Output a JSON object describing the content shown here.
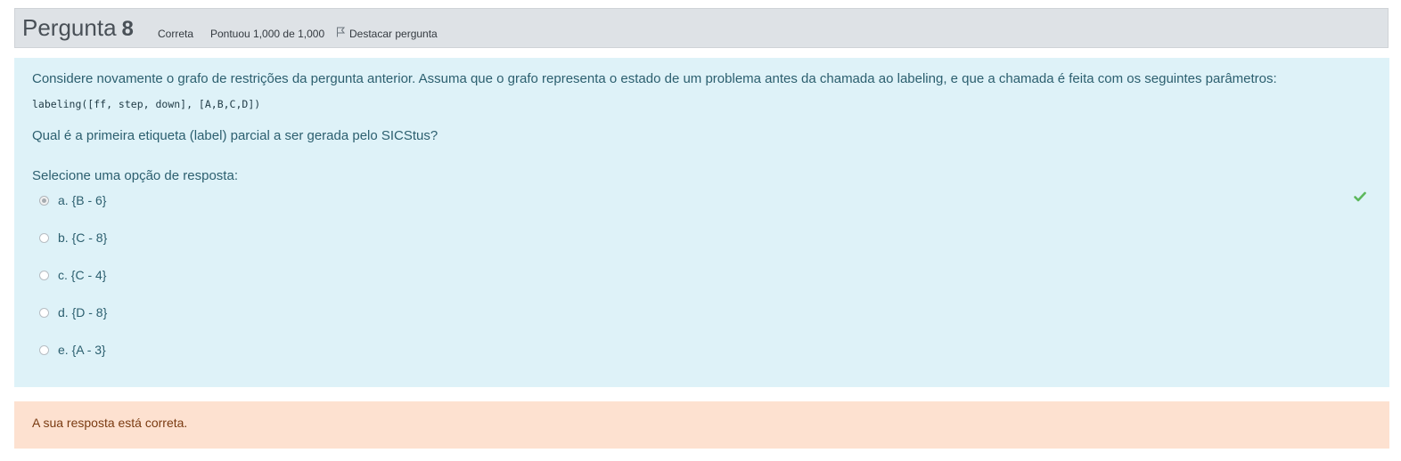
{
  "question": {
    "word": "Pergunta",
    "number": "8",
    "state": "Correta",
    "grade": "Pontuou 1,000 de 1,000",
    "flag_label": "Destacar pergunta",
    "flag_icon": "flag-icon"
  },
  "content": {
    "text1": "Considere novamente o grafo de restrições da pergunta anterior. Assuma que o grafo representa o estado de um problema antes da chamada ao labeling, e que a chamada é feita com os seguintes parâmetros:",
    "code": "labeling([ff, step, down], [A,B,C,D])",
    "text2": "Qual é a primeira etiqueta (label) parcial a ser gerada pelo SICStus?",
    "prompt": "Selecione uma opção de resposta:",
    "options": [
      {
        "label": "a. {B - 6}",
        "selected": true
      },
      {
        "label": "b. {C - 8}",
        "selected": false
      },
      {
        "label": "c. {C - 4}",
        "selected": false
      },
      {
        "label": "d. {D - 8}",
        "selected": false
      },
      {
        "label": "e. {A - 3}",
        "selected": false
      }
    ],
    "correct_icon": "check-icon",
    "correct_color": "#5cb85c"
  },
  "feedback": {
    "text": "A sua resposta está correta."
  },
  "colors": {
    "header_bg": "#dee2e6",
    "content_bg": "#def2f8",
    "feedback_bg": "#fde1d0"
  }
}
